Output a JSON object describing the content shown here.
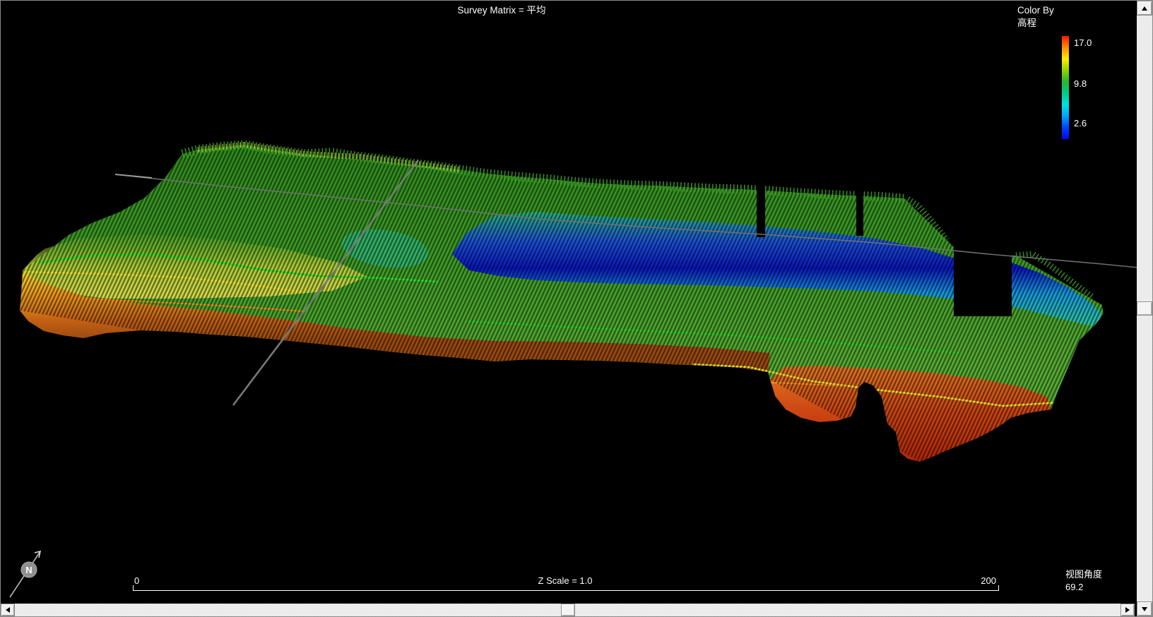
{
  "title": "Survey Matrix = 平均",
  "legend": {
    "title_line1": "Color By",
    "title_line2": "高程",
    "max_label": "17.0",
    "mid_label": "9.8",
    "min_label": "2.6",
    "gradient": [
      "#ff1500",
      "#ff8c00",
      "#ffee00",
      "#90d400",
      "#22b832",
      "#00c98e",
      "#00e0e0",
      "#00a4ff",
      "#0040ff",
      "#0008f0"
    ]
  },
  "scale_bar": {
    "left_label": "0",
    "center_label": "Z Scale = 1.0",
    "right_label": "200"
  },
  "view_angle": {
    "label": "视图角度",
    "value": "69.2"
  },
  "north_indicator": {
    "label": "N"
  },
  "chart_data": {
    "type": "heatmap",
    "subtype": "3d-survey-matrix-surface",
    "title": "Survey Matrix = 平均",
    "color_by": "高程",
    "color_scale": {
      "max": 17.0,
      "mid": 9.8,
      "min": 2.6
    },
    "distance_scale": {
      "start": 0,
      "end": 200
    },
    "z_scale": 1.0,
    "view_angle_deg": 69.2,
    "legend_position": "top-right",
    "notes_visible_features": "rainbow elevation coloring: red/orange shallow front slopes, green mid terrain, deep blue channel through center, survey track line crossing surface"
  }
}
